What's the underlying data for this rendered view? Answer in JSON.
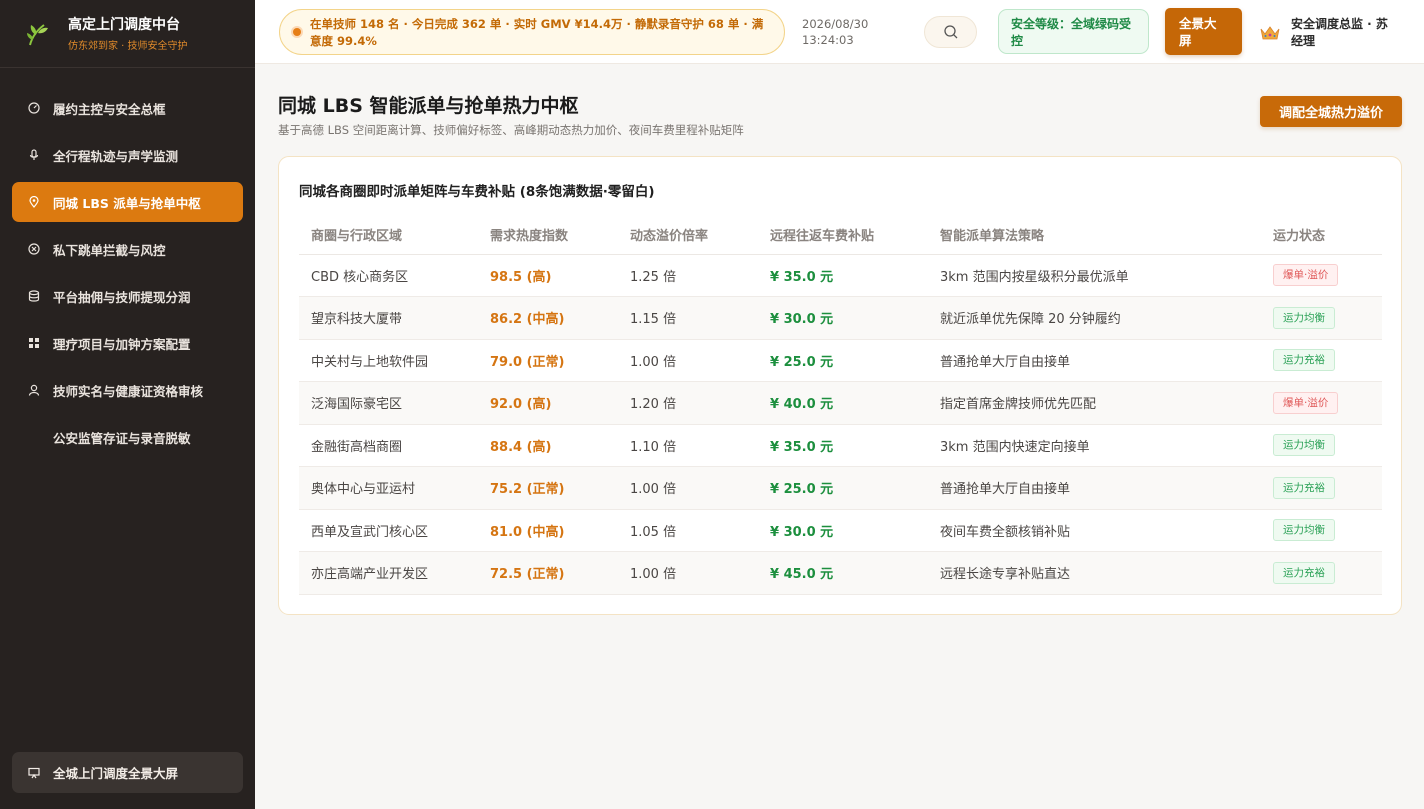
{
  "brand": {
    "title": "高定上门调度中台",
    "subtitle": "仿东郊到家 · 技师安全守护"
  },
  "sidebar": {
    "items": [
      {
        "label": "履约主控与安全总框",
        "icon": "dashboard-icon",
        "active": false
      },
      {
        "label": "全行程轨迹与声学监测",
        "icon": "microphone-icon",
        "active": false
      },
      {
        "label": "同城 LBS 派单与抢单中枢",
        "icon": "location-pin-icon",
        "active": true
      },
      {
        "label": "私下跳单拦截与风控",
        "icon": "block-icon",
        "active": false
      },
      {
        "label": "平台抽佣与技师提现分润",
        "icon": "database-icon",
        "active": false
      },
      {
        "label": "理疗项目与加钟方案配置",
        "icon": "grid-icon",
        "active": false
      },
      {
        "label": "技师实名与健康证资格审核",
        "icon": "user-icon",
        "active": false
      },
      {
        "label": "公安监管存证与录音脱敏",
        "icon": "",
        "active": false
      }
    ],
    "bottom_label": "全城上门调度全景大屏"
  },
  "topbar": {
    "ticker": "在单技师 148 名 · 今日完成 362 单 · 实时 GMV ¥14.4万 · 静默录音守护 68 单 · 满意度 99.4%",
    "date": "2026/08/30",
    "time": "13:24:03",
    "safety": "安全等级：全域绿码受控",
    "screen_button": "全景大屏",
    "user_name": "安全调度总监 · 苏经理"
  },
  "page": {
    "title": "同城 LBS 智能派单与抢单热力中枢",
    "subtitle": "基于高德 LBS 空间距离计算、技师偏好标签、高峰期动态热力加价、夜间车费里程补贴矩阵",
    "primary_button": "调配全城热力溢价"
  },
  "card": {
    "title": "同城各商圈即时派单矩阵与车费补贴 (8条饱满数据·零留白)",
    "columns": [
      "商圈与行政区域",
      "需求热度指数",
      "动态溢价倍率",
      "远程往返车费补贴",
      "智能派单算法策略",
      "运力状态"
    ],
    "rows": [
      {
        "area": "CBD 核心商务区",
        "heat": "98.5 (高)",
        "rate": "1.25 倍",
        "fee": "¥ 35.0 元",
        "strategy": "3km 范围内按星级积分最优派单",
        "status": "爆单·溢价",
        "status_type": "hot"
      },
      {
        "area": "望京科技大厦带",
        "heat": "86.2 (中高)",
        "rate": "1.15 倍",
        "fee": "¥ 30.0 元",
        "strategy": "就近派单优先保障 20 分钟履约",
        "status": "运力均衡",
        "status_type": "ok"
      },
      {
        "area": "中关村与上地软件园",
        "heat": "79.0 (正常)",
        "rate": "1.00 倍",
        "fee": "¥ 25.0 元",
        "strategy": "普通抢单大厅自由接单",
        "status": "运力充裕",
        "status_type": "ok"
      },
      {
        "area": "泛海国际豪宅区",
        "heat": "92.0 (高)",
        "rate": "1.20 倍",
        "fee": "¥ 40.0 元",
        "strategy": "指定首席金牌技师优先匹配",
        "status": "爆单·溢价",
        "status_type": "hot"
      },
      {
        "area": "金融街高档商圈",
        "heat": "88.4 (高)",
        "rate": "1.10 倍",
        "fee": "¥ 35.0 元",
        "strategy": "3km 范围内快速定向接单",
        "status": "运力均衡",
        "status_type": "ok"
      },
      {
        "area": "奥体中心与亚运村",
        "heat": "75.2 (正常)",
        "rate": "1.00 倍",
        "fee": "¥ 25.0 元",
        "strategy": "普通抢单大厅自由接单",
        "status": "运力充裕",
        "status_type": "ok"
      },
      {
        "area": "西单及宣武门核心区",
        "heat": "81.0 (中高)",
        "rate": "1.05 倍",
        "fee": "¥ 30.0 元",
        "strategy": "夜间车费全额核销补贴",
        "status": "运力均衡",
        "status_type": "ok"
      },
      {
        "area": "亦庄高端产业开发区",
        "heat": "72.5 (正常)",
        "rate": "1.00 倍",
        "fee": "¥ 45.0 元",
        "strategy": "远程长途专享补贴直达",
        "status": "运力充裕",
        "status_type": "ok"
      }
    ]
  },
  "colors": {
    "accent": "#dc7a10",
    "sidebar_bg": "#272220",
    "fee_green": "#1c8f3e",
    "hot_red": "#e05a5a"
  }
}
